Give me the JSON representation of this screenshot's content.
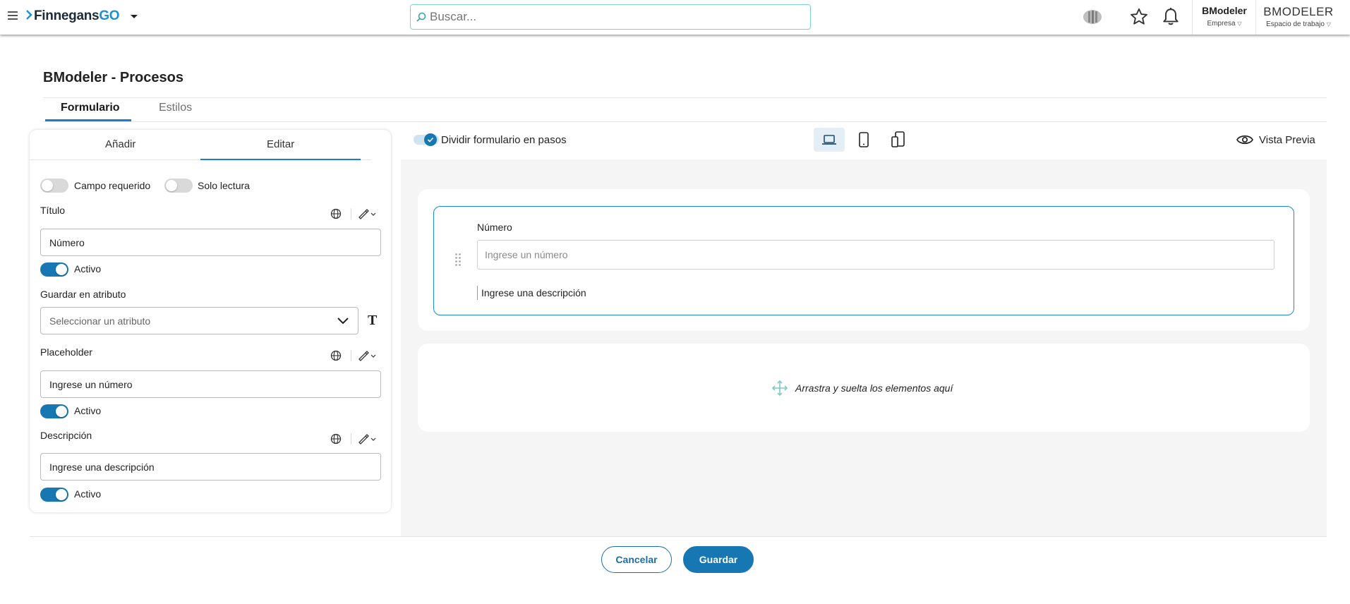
{
  "header": {
    "brand_main": "Finnegans",
    "brand_go": "GO",
    "search_placeholder": "Buscar...",
    "company_name": "BModeler",
    "company_label": "Empresa",
    "workspace_name": "BMODELER",
    "workspace_label": "Espacio de trabajo"
  },
  "page": {
    "title": "BModeler - Procesos",
    "tabs": [
      {
        "label": "Formulario",
        "active": true
      },
      {
        "label": "Estilos",
        "active": false
      }
    ]
  },
  "left_panel": {
    "tabs": [
      {
        "label": "Añadir",
        "active": false
      },
      {
        "label": "Editar",
        "active": true
      }
    ],
    "campo_requerido": {
      "label": "Campo requerido",
      "on": false
    },
    "solo_lectura": {
      "label": "Solo lectura",
      "on": false
    },
    "titulo": {
      "label": "Título",
      "value": "Número",
      "active_label": "Activo",
      "active": true
    },
    "guardar_atributo": {
      "label": "Guardar en atributo",
      "placeholder": "Seleccionar un atributo"
    },
    "placeholder": {
      "label": "Placeholder",
      "value": "Ingrese un número",
      "active_label": "Activo",
      "active": true
    },
    "descripcion": {
      "label": "Descripción",
      "value": "Ingrese una descripción",
      "active_label": "Activo",
      "active": true
    }
  },
  "canvas": {
    "split_steps_label": "Dividir formulario en pasos",
    "split_steps_on": true,
    "devices": [
      {
        "icon": "laptop-icon",
        "active": true
      },
      {
        "icon": "tablet-icon",
        "active": false
      },
      {
        "icon": "mobile-icon",
        "active": false
      }
    ],
    "preview_label": "Vista Previa",
    "field": {
      "label": "Número",
      "placeholder": "Ingrese un número",
      "description": "Ingrese una descripción"
    },
    "drop_message": "Arrastra y suelta los elementos aquí"
  },
  "footer": {
    "cancel_label": "Cancelar",
    "save_label": "Guardar"
  },
  "colors": {
    "accent": "#1677b3",
    "tab_indicator": "#1d7fc1",
    "search_border": "#7fd1cf"
  }
}
